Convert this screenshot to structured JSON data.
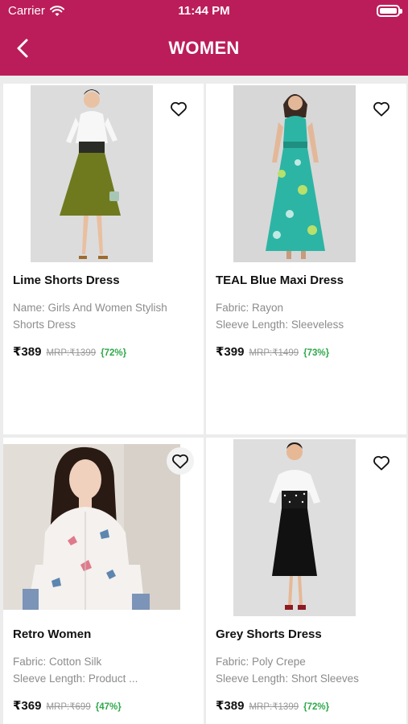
{
  "status_bar": {
    "carrier": "Carrier",
    "time": "11:44 PM"
  },
  "header": {
    "title": "WOMEN"
  },
  "products": [
    {
      "name": "Lime Shorts Dress",
      "details": [
        "Name: Girls And Women Stylish",
        "Shorts Dress"
      ],
      "price": "₹389",
      "mrp": "MRP:₹1399",
      "discount": "{72%}",
      "dress_color": "#6f7a1f"
    },
    {
      "name": "TEAL Blue Maxi Dress",
      "details": [
        "Fabric: Rayon",
        "Sleeve Length: Sleeveless"
      ],
      "price": "₹399",
      "mrp": "MRP:₹1499",
      "discount": "{73%}",
      "dress_color": "#2cb5a4"
    },
    {
      "name": "Retro Women",
      "details": [
        "Fabric: Cotton Silk",
        "Sleeve Length: Product ..."
      ],
      "price": "₹369",
      "mrp": "MRP:₹699",
      "discount": "{47%}",
      "dress_color": "#f4f1ee"
    },
    {
      "name": "Grey Shorts Dress",
      "details": [
        "Fabric: Poly Crepe",
        "Sleeve Length: Short Sleeves"
      ],
      "price": "₹389",
      "mrp": "MRP:₹1399",
      "discount": "{72%}",
      "dress_color": "#111111"
    }
  ],
  "colors": {
    "brand": "#bb1d5a",
    "discount": "#2fa84b"
  },
  "icons": {
    "back": "chevron-left-icon",
    "wishlist": "heart-outline-icon"
  }
}
